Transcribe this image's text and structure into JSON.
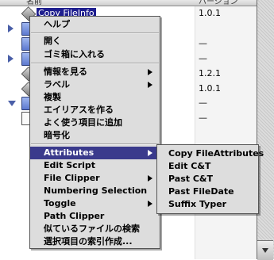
{
  "finder": {
    "columns": {
      "name": "名前",
      "version": "バージョン"
    },
    "selected_item": "Copy FileInfo",
    "rows": [
      {
        "version": "1.0.1"
      },
      {
        "version": ""
      },
      {
        "version": "—"
      },
      {
        "version": "—"
      },
      {
        "version": ""
      },
      {
        "version": "1.2.1"
      },
      {
        "version": "1.0.1"
      },
      {
        "version": "—"
      },
      {
        "version": "—"
      }
    ]
  },
  "context_menu": {
    "items": [
      "ヘルプ",
      "開く",
      "ゴミ箱に入れる",
      "情報を見る",
      "ラベル",
      "複製",
      "エイリアスを作る",
      "よく使う項目に追加",
      "暗号化",
      "Attributes",
      "Edit Script",
      "File Clipper",
      "Numbering Selection",
      "Toggle",
      "Path Clipper",
      "似ているファイルの検索",
      "選択項目の索引作成..."
    ]
  },
  "submenu": {
    "items": [
      "Copy FileAttributes",
      "Edit C&T",
      "Past C&T",
      "Past FileDate",
      "Suffix Typer"
    ]
  },
  "colors": {
    "highlight": "#3a3a8c",
    "menu_bg": "#dddddd",
    "selection": "#1f1f8f"
  }
}
